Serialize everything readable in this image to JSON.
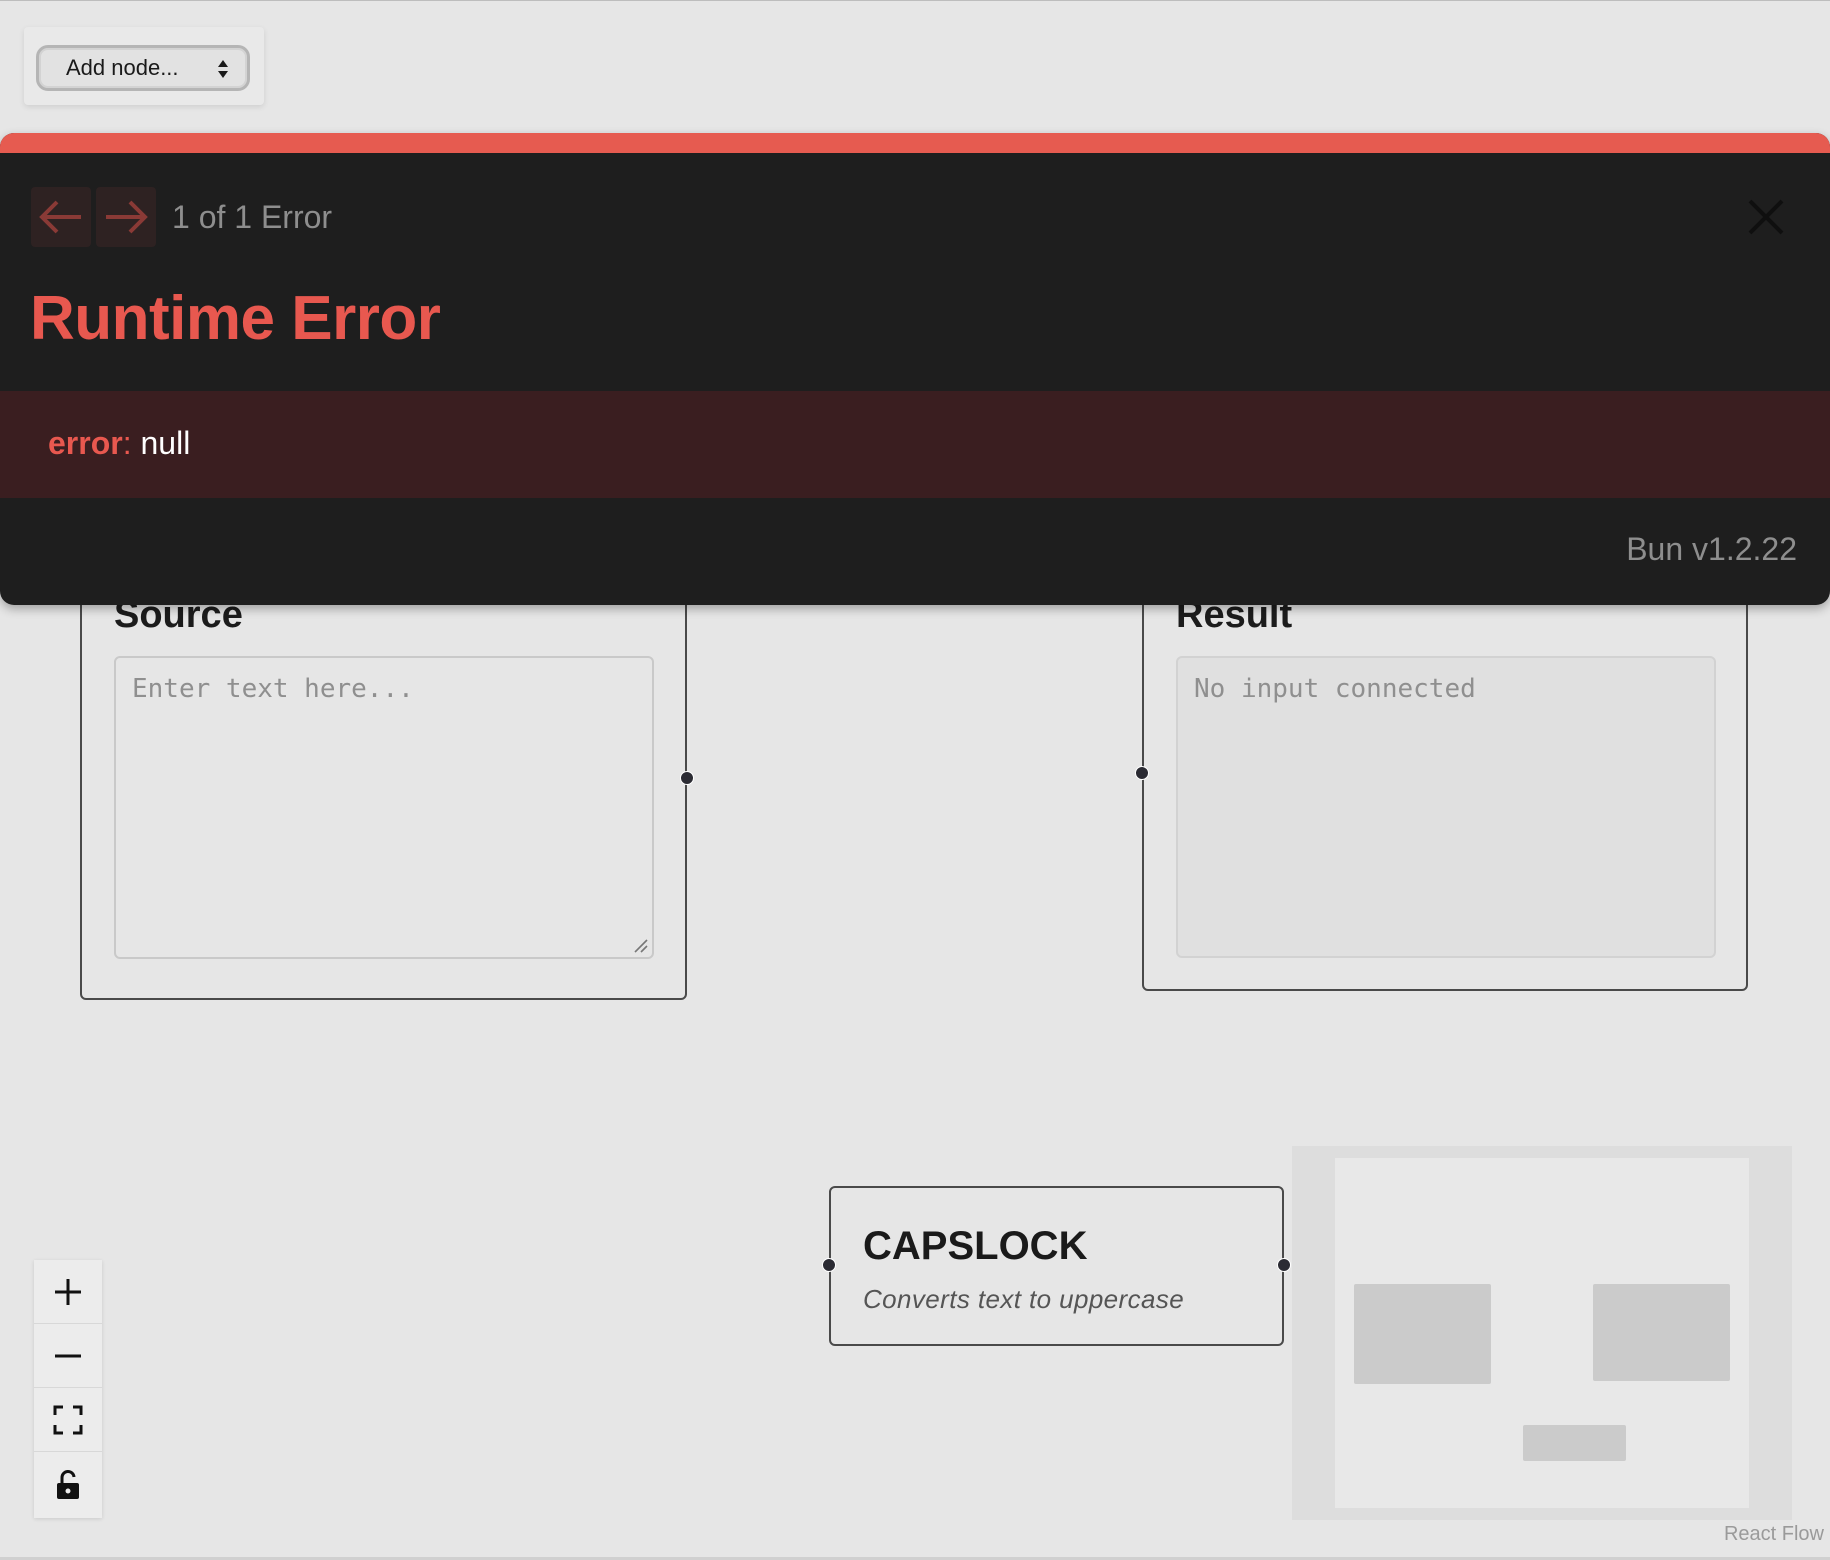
{
  "toolbar": {
    "add_node_label": "Add node..."
  },
  "nodes": {
    "source": {
      "title": "Source",
      "placeholder": "Enter text here..."
    },
    "result": {
      "title": "Result",
      "value": "No input connected"
    },
    "capslock": {
      "title": "CAPSLOCK",
      "description": "Converts text to uppercase"
    }
  },
  "controls": {
    "icons": [
      "plus-icon",
      "minus-icon",
      "fit-view-icon",
      "lock-icon"
    ]
  },
  "attribution": "React Flow",
  "error_overlay": {
    "count_text": "1 of 1 Error",
    "title": "Runtime Error",
    "message_key": "error",
    "message_sep": ": ",
    "message_value": "null",
    "version": "Bun v1.2.22",
    "accent_color": "#e65b50"
  }
}
